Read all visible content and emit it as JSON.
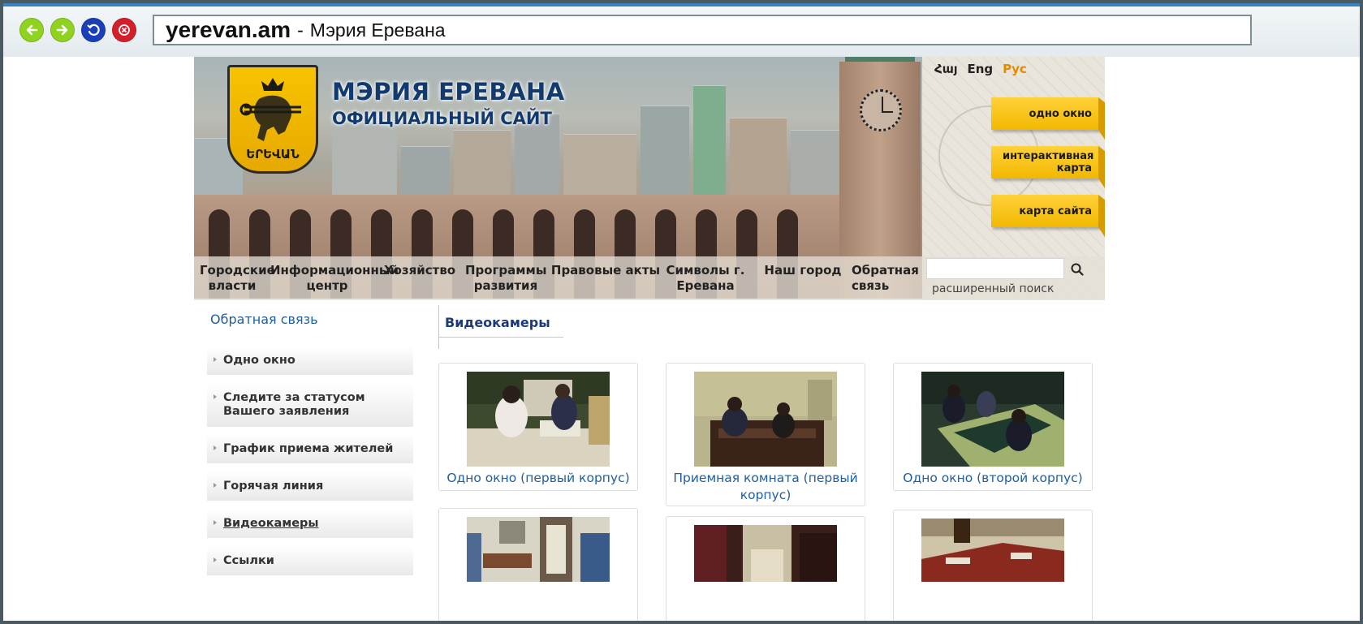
{
  "browser": {
    "host": "yerevan.am",
    "separator": "-",
    "page_title": "Мэрия Еревана"
  },
  "header": {
    "title": "МЭРИЯ ЕРЕВАНА",
    "subtitle": "ОФИЦИАЛЬНЫЙ САЙТ",
    "crest_text": "ԵՐԵՎԱՆ",
    "languages": [
      {
        "label": "Հայ",
        "active": false
      },
      {
        "label": "Eng",
        "active": false
      },
      {
        "label": "Рус",
        "active": true
      }
    ],
    "quick_links": {
      "one_window": "одно окно",
      "interactive_map": "интерактивная карта",
      "sitemap": "карта сайта"
    }
  },
  "topnav": [
    "Городские власти",
    "Информационный центр",
    "Хозяйство",
    "Программы развития",
    "Правовые акты",
    "Символы г. Еревана",
    "Наш город",
    "Обратная связь"
  ],
  "search": {
    "value": "",
    "advanced_label": "расширенный поиск"
  },
  "sidebar": {
    "title": "Обратная связь",
    "items": [
      {
        "label": "Одно окно",
        "active": false
      },
      {
        "label": "Следите за статусом Вашего заявления",
        "active": false
      },
      {
        "label": "График приема жителей",
        "active": false
      },
      {
        "label": "Горячая линия",
        "active": false
      },
      {
        "label": "Видеокамеры",
        "active": true
      },
      {
        "label": "Ссылки",
        "active": false
      }
    ]
  },
  "main": {
    "section_title": "Видеокамеры",
    "cameras": [
      {
        "caption": "Одно окно (первый корпус)"
      },
      {
        "caption": "Приемная комната (первый корпус)"
      },
      {
        "caption": "Одно окно (второй корпус)"
      },
      {
        "caption": ""
      },
      {
        "caption": ""
      },
      {
        "caption": ""
      }
    ]
  },
  "colors": {
    "link_blue": "#1f5ea0",
    "title_navy": "#123a6e",
    "active_lang": "#e28a00",
    "tab_yellow": "#f7c400"
  }
}
